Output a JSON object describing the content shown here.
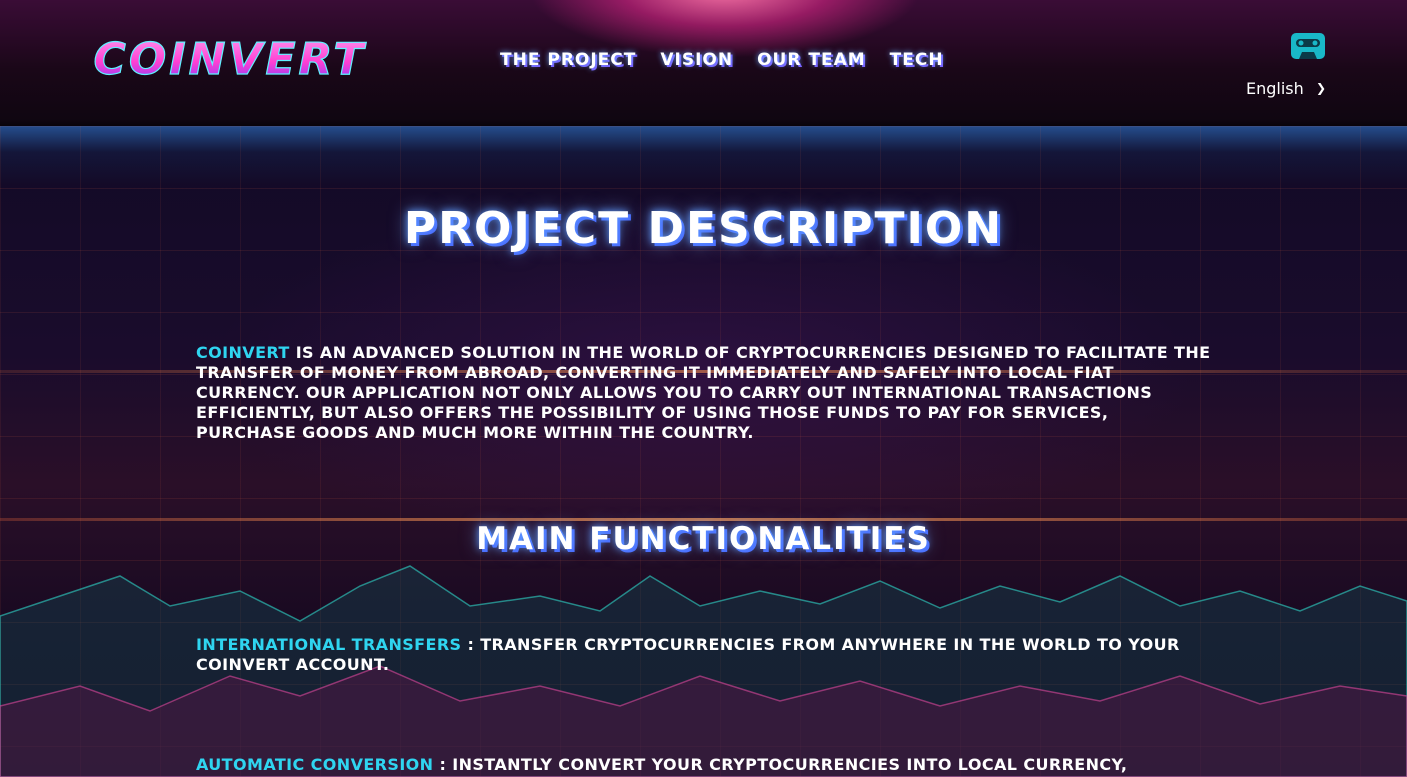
{
  "header": {
    "logo_text": "COINVERT",
    "nav": [
      "The Project",
      "Vision",
      "Our Team",
      "Tech"
    ],
    "language": "English",
    "music_icon": "cassette-icon"
  },
  "content": {
    "title": "PROJECT DESCRIPTION",
    "intro_brand": "COINVERT",
    "intro_text": " IS AN ADVANCED SOLUTION IN THE WORLD OF CRYPTOCURRENCIES DESIGNED TO FACILITATE THE TRANSFER OF MONEY FROM ABROAD, CONVERTING IT IMMEDIATELY AND SAFELY INTO LOCAL FIAT CURRENCY. OUR APPLICATION NOT ONLY ALLOWS YOU TO CARRY OUT INTERNATIONAL TRANSACTIONS EFFICIENTLY, BUT ALSO OFFERS THE POSSIBILITY OF USING THOSE FUNDS TO PAY FOR SERVICES, PURCHASE GOODS AND MUCH MORE WITHIN THE COUNTRY.",
    "subtitle": "MAIN FUNCTIONALITIES",
    "features": [
      {
        "name": "INTERNATIONAL TRANSFERS",
        "text": " : TRANSFER CRYPTOCURRENCIES FROM ANYWHERE IN THE WORLD TO YOUR COINVERT ACCOUNT."
      },
      {
        "name": "AUTOMATIC CONVERSION",
        "text": " : INSTANTLY CONVERT YOUR CRYPTOCURRENCIES INTO LOCAL CURRENCY,"
      }
    ]
  },
  "colors": {
    "accent_cyan": "#2fd5f0",
    "logo_pink": "#ff4fd8",
    "header_glow": "#e8308c"
  }
}
